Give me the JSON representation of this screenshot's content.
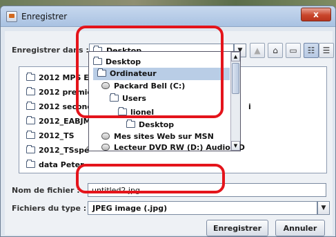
{
  "window": {
    "title": "Enregistrer",
    "close_glyph": "x"
  },
  "save_in": {
    "label": "Enregistrer dans :",
    "value": "Desktop"
  },
  "files": [
    "2012 MPS EERE",
    "2012 première S",
    "2012 seconde s",
    "2012_EABJM_6",
    "2012_TS",
    "2012_TSspé",
    "data Peter"
  ],
  "hidden_suffix": "i",
  "dropdown": [
    {
      "label": "Desktop",
      "icon": "folder-icon",
      "indent": 0
    },
    {
      "label": "Ordinateur",
      "icon": "folder-icon",
      "indent": 1,
      "selected": true
    },
    {
      "label": "Packard Bell (C:)",
      "icon": "disk-icon",
      "indent": 2
    },
    {
      "label": "Users",
      "icon": "folder-icon",
      "indent": 3
    },
    {
      "label": "lionel",
      "icon": "folder-icon",
      "indent": 4
    },
    {
      "label": "Desktop",
      "icon": "folder-icon",
      "indent": 5
    },
    {
      "label": "Mes sites Web sur MSN",
      "icon": "disk-icon",
      "indent": 2
    },
    {
      "label": "Lecteur DVD RW (D:) Audio CD",
      "icon": "disk-icon",
      "indent": 2
    }
  ],
  "filename": {
    "label": "Nom de fichier :",
    "value": "untitled2.jpg"
  },
  "filetype": {
    "label": "Fichiers du type :",
    "value": "JPEG image (.jpg)"
  },
  "buttons": {
    "save": "Enregistrer",
    "cancel": "Annuler"
  },
  "toolbar_glyphs": {
    "up": "▲",
    "home": "⌂",
    "new_folder": "▭",
    "list": "☷",
    "details": "☰"
  },
  "colors": {
    "highlight": "#e4141b",
    "selection": "#b9cde6"
  }
}
